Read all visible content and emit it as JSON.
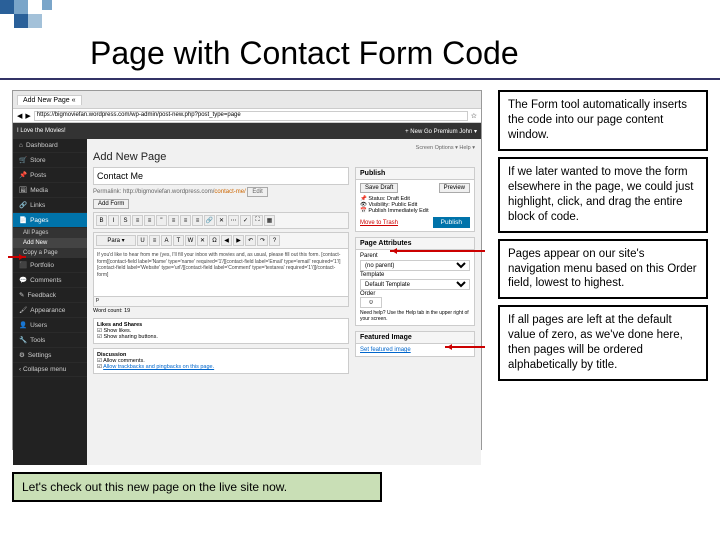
{
  "title": "Page with Contact Form Code",
  "browser": {
    "tab": "Add New Page «",
    "url": "https://bigmoviefan.wordpress.com/wp-admin/post-new.php?post_type=page"
  },
  "wp": {
    "site": "I Love the Movies!",
    "topbar_right": "+ New   Go Premium   John ▾",
    "screen_options": "Screen Options ▾   Help ▾",
    "h1": "Add New Page",
    "sidebar": [
      "Dashboard",
      "Store",
      "Posts",
      "Media",
      "Links",
      "Pages",
      "Portfolio",
      "Comments",
      "Feedback",
      "Appearance",
      "Users",
      "Tools",
      "Settings",
      "‹ Collapse menu"
    ],
    "sub": [
      "All Pages",
      "Add New",
      "Copy a Page"
    ],
    "page_title": "Contact Me",
    "permalink_label": "Permalink:",
    "permalink_base": "http://bigmoviefan.wordpress.com/",
    "permalink_slug": "contact-me/",
    "edit": "Edit",
    "add_form": "Add Form",
    "editor_text": "If you'd like to hear from me (yes, I'll fill your inbox with movies and, as usual, please fill out this form.\n[contact-form][contact-field label='Name' type='name' required='1'/][contact-field label='Email' type='email' required='1'/][contact-field label='Website' type='url'/][contact-field label='Comment' type='textarea' required='1'/][/contact-form]",
    "word_count": "Word count: 19",
    "publish": {
      "title": "Publish",
      "save_draft": "Save Draft",
      "preview": "Preview",
      "status": "Status: Draft Edit",
      "visibility": "Visibility: Public Edit",
      "publish_now": "Publish Immediately Edit",
      "move_trash": "Move to Trash",
      "publish_btn": "Publish"
    },
    "attrs": {
      "title": "Page Attributes",
      "parent": "Parent",
      "parent_val": "(no parent)",
      "template": "Template",
      "template_val": "Default Template",
      "order": "Order",
      "order_val": "0",
      "help": "Need help? Use the Help tab in the upper right of your screen."
    },
    "likes": {
      "title": "Likes and Shares",
      "show": "Show likes.",
      "sharing": "Show sharing buttons."
    },
    "featured": {
      "title": "Featured Image",
      "set": "Set featured image"
    },
    "discussion": {
      "title": "Discussion",
      "allow": "Allow comments.",
      "track": "Allow trackbacks and pingbacks on this page."
    }
  },
  "callouts": [
    "The Form tool automatically inserts the code into our page content window.",
    "If we later wanted to move the form elsewhere in the page, we could just highlight, click, and drag the entire block of code.",
    "Pages appear on our site's navigation menu based on this Order field, lowest to highest.",
    "If all pages are left at the default value of zero, as we've done here, then pages will be ordered alphabetically by title."
  ],
  "bottom": "Let's check out this new page on the live site now."
}
